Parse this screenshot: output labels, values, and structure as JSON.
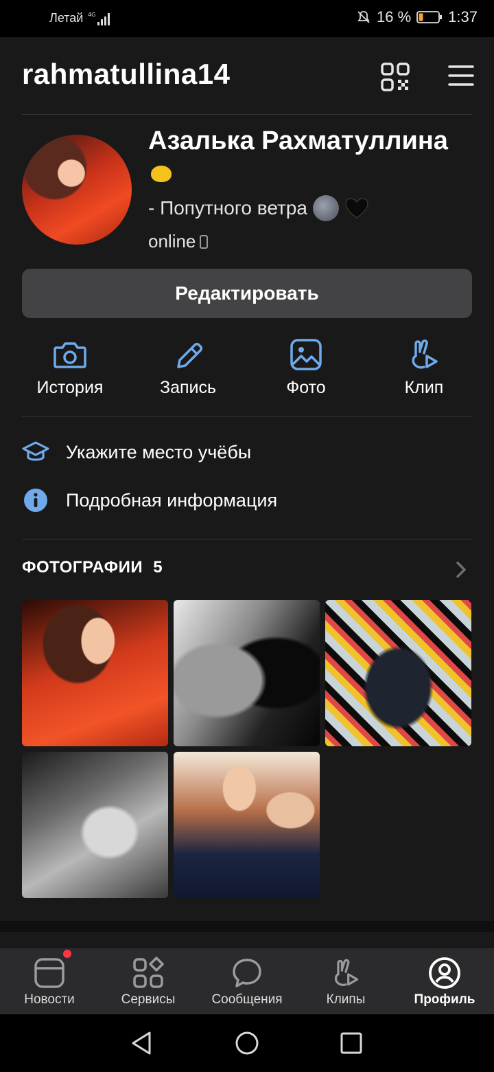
{
  "status_bar": {
    "carrier": "Летай",
    "battery": "16 %",
    "time": "1:37"
  },
  "header": {
    "username": "rahmatullina14",
    "qr_icon": "qr-code-icon",
    "menu_icon": "hamburger-menu-icon"
  },
  "profile": {
    "name": "Азалька Рахматуллина",
    "status": "- Попутного ветра",
    "presence": "online",
    "edit_label": "Редактировать"
  },
  "actions": [
    {
      "label": "История",
      "icon": "camera-icon"
    },
    {
      "label": "Запись",
      "icon": "pencil-icon"
    },
    {
      "label": "Фото",
      "icon": "image-icon"
    },
    {
      "label": "Клип",
      "icon": "clip-icon"
    }
  ],
  "info": {
    "education": "Укажите место учёбы",
    "details": "Подробная информация"
  },
  "photos": {
    "title": "ФОТОГРАФИИ",
    "count": "5"
  },
  "tabbar": [
    {
      "label": "Новости",
      "icon": "news-icon",
      "badge": true
    },
    {
      "label": "Сервисы",
      "icon": "services-icon"
    },
    {
      "label": "Сообщения",
      "icon": "messages-icon"
    },
    {
      "label": "Клипы",
      "icon": "clips-icon"
    },
    {
      "label": "Профиль",
      "icon": "profile-icon",
      "active": true
    }
  ],
  "colors": {
    "accent": "#71aaeb",
    "background": "#19191a",
    "button": "#434346",
    "badge": "#ff3347"
  }
}
